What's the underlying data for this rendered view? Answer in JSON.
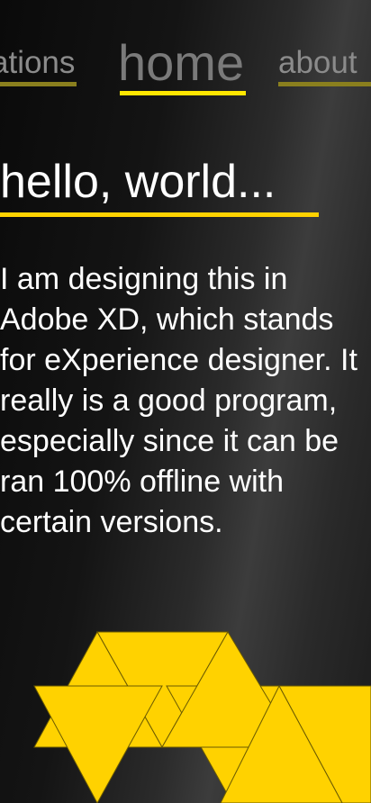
{
  "nav": {
    "items": [
      {
        "label": "ations",
        "state": "inactive"
      },
      {
        "label": "home",
        "state": "active"
      },
      {
        "label": "about",
        "state": "inactive"
      }
    ]
  },
  "main": {
    "heading": "hello, world...",
    "paragraph": "I am designing this in Adobe XD, which stands for eXperience designer. It really is a good program, especially since it can be ran 100% offline with certain versions."
  },
  "colors": {
    "accent": "#ffd200",
    "inactive_accent": "#8a7f1e",
    "text": "#ffffff",
    "muted_text": "#8b8b8b"
  }
}
